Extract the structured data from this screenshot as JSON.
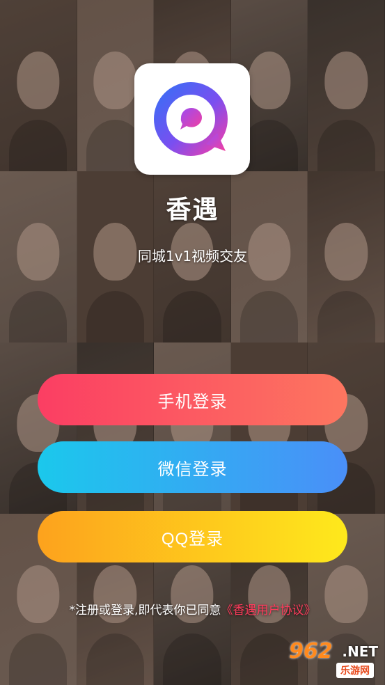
{
  "background": {
    "tiles": [
      "woman-portrait",
      "woman-portrait",
      "woman-portrait",
      "woman-portrait",
      "woman-portrait",
      "man-portrait",
      "woman-portrait",
      "man-portrait",
      "woman-portrait",
      "woman-portrait",
      "man-portrait",
      "woman-portrait",
      "woman-portrait",
      "woman-portrait",
      "woman-portrait",
      "woman-portrait",
      "woman-portrait",
      "woman-portrait",
      "woman-portrait",
      "woman-portrait"
    ]
  },
  "app": {
    "logo_icon": "chat-bubble-logo-icon",
    "name": "香遇",
    "tagline": "同城1v1视频交友"
  },
  "buttons": {
    "phone": "手机登录",
    "wechat": "微信登录",
    "qq": "QQ登录"
  },
  "colors": {
    "phone_start": "#fb3e63",
    "phone_end": "#fd7660",
    "wechat_start": "#1bc8ec",
    "wechat_end": "#4a8ff8",
    "qq_start": "#fda21d",
    "qq_end": "#fee91c",
    "link": "#ff3b5c"
  },
  "agreement": {
    "prefix": "*注册或登录,即代表你已同意",
    "link": "《香遇用户协议》"
  },
  "watermark": {
    "number": "962",
    "domain": ".NET",
    "chinese": "乐游网"
  }
}
